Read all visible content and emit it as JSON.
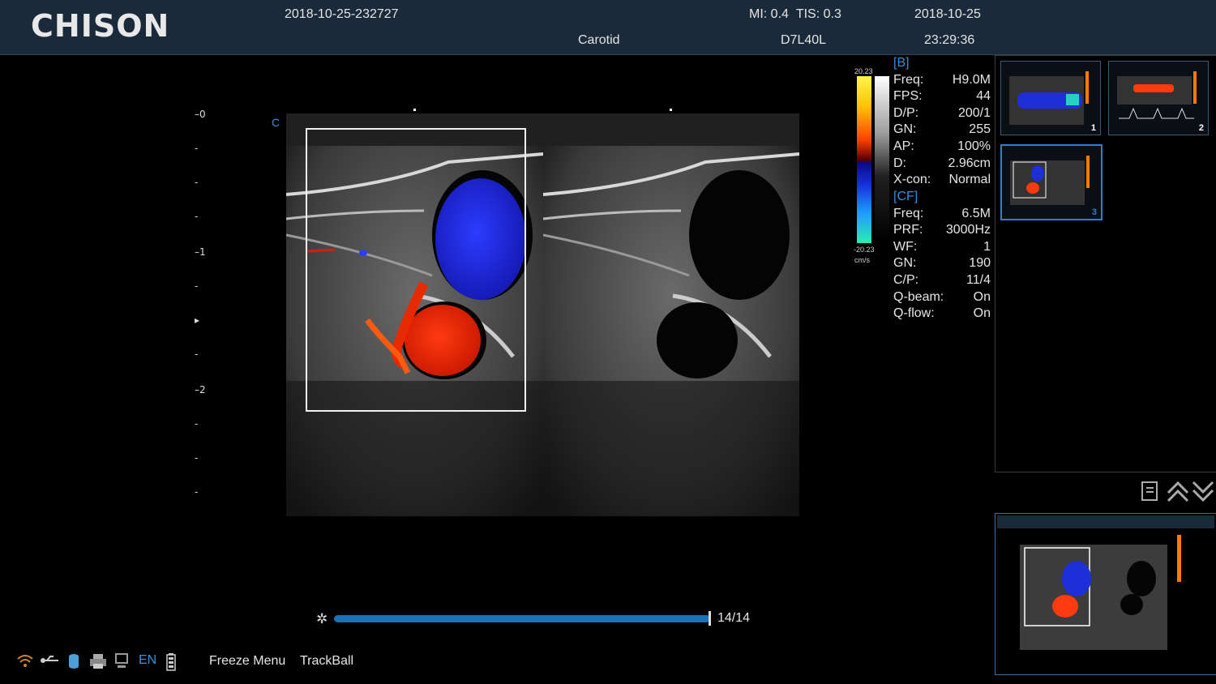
{
  "header": {
    "logo": "CHISON",
    "exam_id": "2018-10-25-232727",
    "preset": "Carotid",
    "mi_label": "MI:",
    "mi_value": "0.4",
    "tis_label": "TIS:",
    "tis_value": "0.3",
    "probe": "D7L40L",
    "date": "2018-10-25",
    "time": "23:29:36"
  },
  "depth_scale": {
    "labels": [
      "0",
      "1",
      "2"
    ],
    "c_marker": "C"
  },
  "color_bar": {
    "max": "20.23",
    "min": "-20.23",
    "unit": "cm/s"
  },
  "params": {
    "b_header": "[B]",
    "b": [
      {
        "label": "Freq:",
        "value": "H9.0M"
      },
      {
        "label": "FPS:",
        "value": "44"
      },
      {
        "label": "D/P:",
        "value": "200/1"
      },
      {
        "label": "GN:",
        "value": "255"
      },
      {
        "label": "AP:",
        "value": "100%"
      },
      {
        "label": "D:",
        "value": "2.96cm"
      },
      {
        "label": "X-con:",
        "value": "Normal"
      }
    ],
    "cf_header": "[CF]",
    "cf": [
      {
        "label": "Freq:",
        "value": "6.5M"
      },
      {
        "label": "PRF:",
        "value": "3000Hz"
      },
      {
        "label": "WF:",
        "value": "1"
      },
      {
        "label": "GN:",
        "value": "190"
      },
      {
        "label": "C/P:",
        "value": "11/4"
      },
      {
        "label": "Q-beam:",
        "value": "On"
      },
      {
        "label": "Q-flow:",
        "value": "On"
      }
    ]
  },
  "thumbnails": [
    {
      "number": "1"
    },
    {
      "number": "2"
    },
    {
      "number": "3",
      "selected": true
    }
  ],
  "cine": {
    "counter": "14/14",
    "position": 1.0
  },
  "status_bar": {
    "language": "EN",
    "menu_items": [
      "Freeze Menu",
      "TrackBall"
    ]
  },
  "colors": {
    "header_bg": "#1b2a3a",
    "accent_blue": "#2f8fe0",
    "cine_bar": "#1a73b8"
  }
}
